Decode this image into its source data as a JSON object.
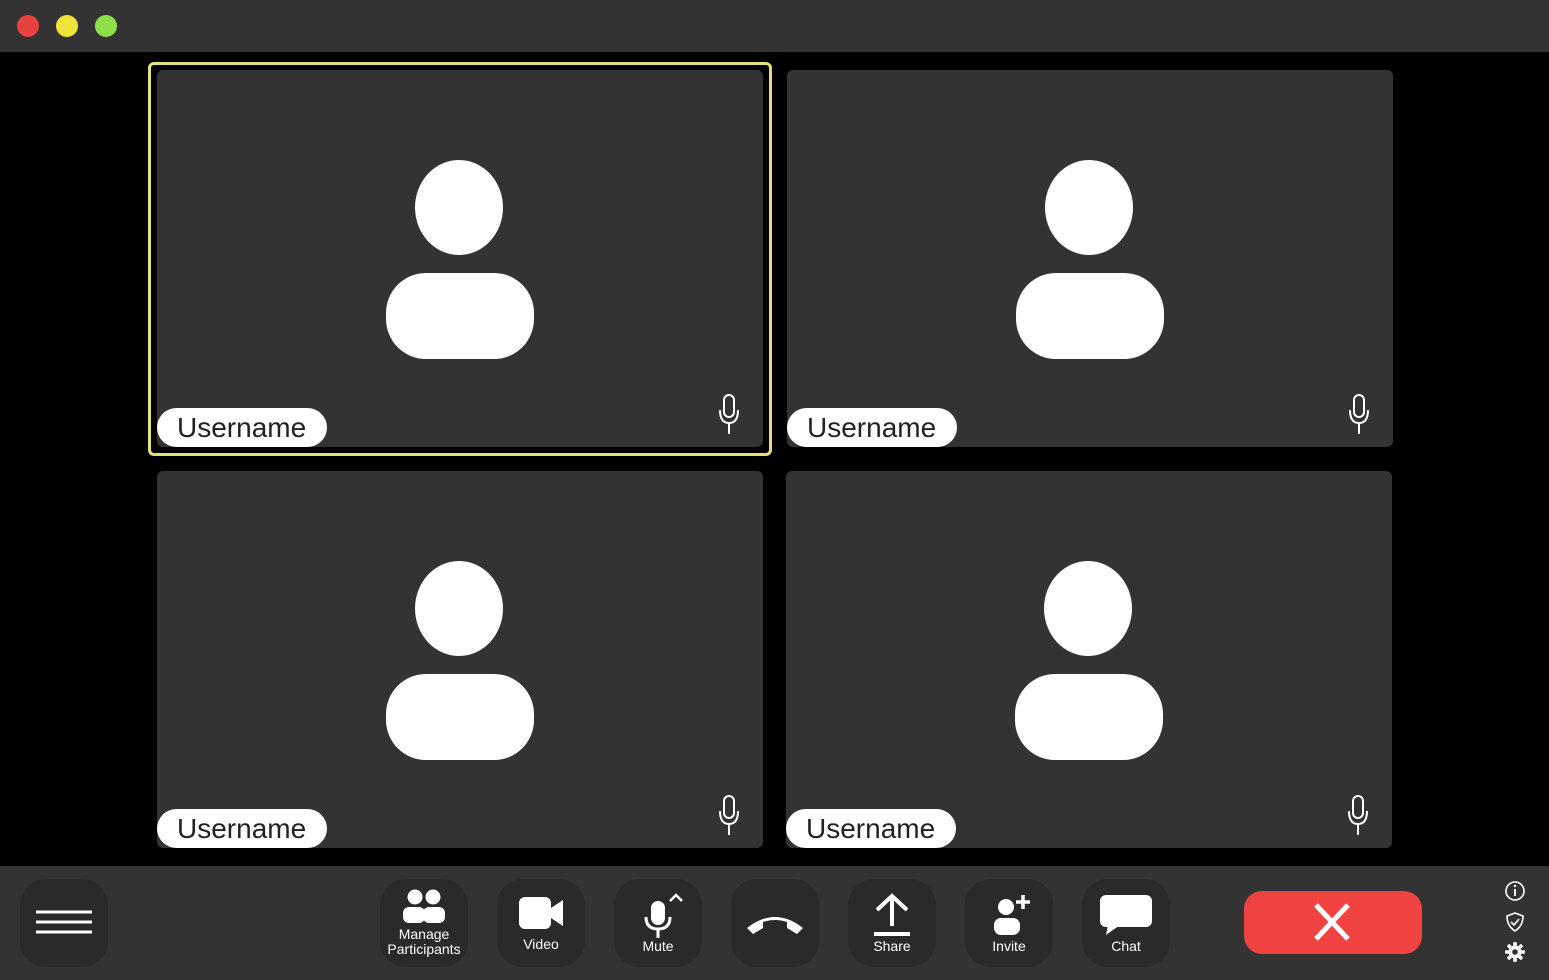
{
  "window": {
    "controls": {
      "close_color": "#e8423f",
      "minimize_color": "#f2e33b",
      "maximize_color": "#8ee04a"
    }
  },
  "colors": {
    "active_speaker_outline": "#e6e07a",
    "end_call": "#f24343"
  },
  "participants": [
    {
      "name": "Username",
      "avatar_icon": "user-avatar-icon",
      "mic_icon": "microphone-icon",
      "active_speaker": true
    },
    {
      "name": "Username",
      "avatar_icon": "user-avatar-icon",
      "mic_icon": "microphone-icon",
      "active_speaker": false
    },
    {
      "name": "Username",
      "avatar_icon": "user-avatar-icon",
      "mic_icon": "microphone-icon",
      "active_speaker": false
    },
    {
      "name": "Username",
      "avatar_icon": "user-avatar-icon",
      "mic_icon": "microphone-icon",
      "active_speaker": false
    }
  ],
  "toolbar": {
    "menu_icon": "hamburger-menu-icon",
    "manage_participants_line1": "Manage",
    "manage_participants_line2": "Participants",
    "video_label": "Video",
    "mute_label": "Mute",
    "hangup_icon": "phone-hangup-icon",
    "share_label": "Share",
    "invite_label": "Invite",
    "chat_label": "Chat",
    "end_icon": "close-x-icon"
  },
  "side_icons": [
    "info-icon",
    "shield-check-icon",
    "gear-icon"
  ]
}
